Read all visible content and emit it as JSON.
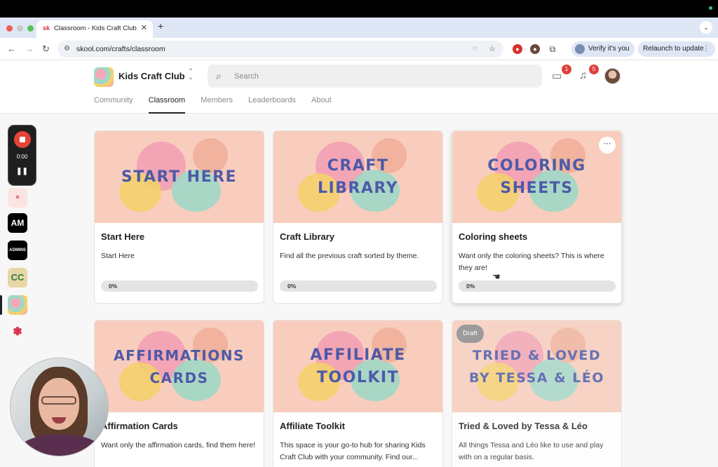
{
  "browser": {
    "tab_title": "Classroom - Kids Craft Club",
    "tab_favicon": "sk",
    "url": "skool.com/crafts/classroom",
    "verify_label": "Verify it's you",
    "relaunch_label": "Relaunch to update"
  },
  "header": {
    "group_name": "Kids Craft Club",
    "search_placeholder": "Search",
    "chat_badge": "1",
    "notification_badge": "5",
    "tabs": [
      {
        "label": "Community",
        "active": false
      },
      {
        "label": "Classroom",
        "active": true
      },
      {
        "label": "Members",
        "active": false
      },
      {
        "label": "Leaderboards",
        "active": false
      },
      {
        "label": "About",
        "active": false
      }
    ]
  },
  "recorder": {
    "time": "0:00"
  },
  "rail": {
    "items": [
      "AM",
      "ADMINS",
      "CC"
    ]
  },
  "courses": [
    {
      "cover_line1": "Start Here",
      "cover_line2": "",
      "title": "Start Here",
      "desc": "Start Here",
      "progress": "0%",
      "draft": false
    },
    {
      "cover_line1": "Craft",
      "cover_line2": "Library",
      "title": "Craft Library",
      "desc": "Find all the previous craft sorted by theme.",
      "progress": "0%",
      "draft": false
    },
    {
      "cover_line1": "Coloring",
      "cover_line2": "Sheets",
      "title": "Coloring sheets",
      "desc": "Want only the coloring sheets? This is where they are!",
      "progress": "0%",
      "draft": false
    },
    {
      "cover_line1": "Affirmations",
      "cover_line2": "Cards",
      "title": "Affirmation Cards",
      "desc": "Want only the affirmation cards, find them here!",
      "progress": "",
      "draft": false
    },
    {
      "cover_line1": "Affiliate",
      "cover_line2": "Toolkit",
      "title": "Affiliate Toolkit",
      "desc": "This space is your go-to hub for sharing Kids Craft Club with your community. Find our...",
      "progress": "",
      "draft": false
    },
    {
      "cover_line1": "Tried & Loved",
      "cover_line2": "by Tessa & Léo",
      "title": "Tried & Loved by Tessa & Léo",
      "desc": "All things Tessa and Léo like to use and play with on a regular basis.",
      "progress": "",
      "draft": true,
      "draft_label": "Draft"
    }
  ],
  "colors": {
    "cover_bg": "#f8cdbd",
    "cover_text": "#4d5aa8",
    "badge_red": "#e0413e",
    "record_red": "#e5443a"
  },
  "icons": [
    "back-arrow-icon",
    "forward-arrow-icon",
    "reload-icon",
    "site-info-icon",
    "eye-off-icon",
    "star-icon",
    "extensions-icon",
    "search-icon",
    "chat-icon",
    "bell-icon",
    "more-icon",
    "hand-cursor-icon"
  ]
}
